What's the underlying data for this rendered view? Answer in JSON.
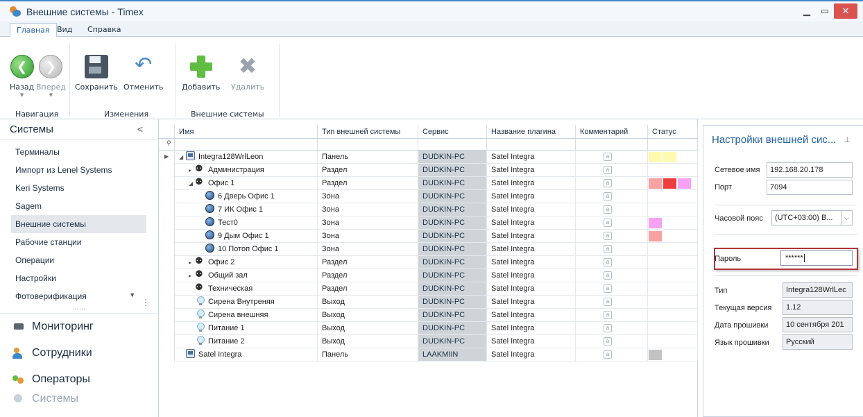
{
  "window": {
    "title": "Внешние системы - Timex"
  },
  "ribbon": {
    "tabs": [
      "Главная",
      "Вид",
      "Справка"
    ],
    "buttons": {
      "back": "Назад",
      "forward": "Вперед",
      "save": "Сохранить",
      "undo": "Отменить",
      "add": "Добавить",
      "delete": "Удалить"
    },
    "groups": {
      "navigation": "Навигация",
      "changes": "Изменения",
      "external_systems": "Внешние системы"
    }
  },
  "left_panel": {
    "header": "Системы",
    "items": [
      "Терминалы",
      "Импорт из Lenel Systems",
      "Keri Systems",
      "Sagem",
      "Внешние системы",
      "Рабочие станции",
      "Операции",
      "Настройки",
      "Фотоверификация"
    ],
    "selected": "Внешние системы",
    "splitter_dots": "......",
    "sections": [
      "Мониторинг",
      "Сотрудники",
      "Операторы",
      "Системы"
    ]
  },
  "grid": {
    "columns": [
      "Имя",
      "Тип внешней системы",
      "Сервис",
      "Название плагина",
      "Комментарий",
      "Статус"
    ],
    "comment_glyph": "a",
    "rows": [
      {
        "name": "Integra128WrlLeon",
        "type": "Панель",
        "service": "DUDKIN-PC",
        "plugin": "Satel Integra",
        "icon": "panel",
        "indent": 1,
        "expander": "◢",
        "status": [
          "#fefbb0",
          "#fefbb0"
        ]
      },
      {
        "name": "Администрация",
        "type": "Раздел",
        "service": "DUDKIN-PC",
        "plugin": "Satel Integra",
        "icon": "section",
        "indent": 2,
        "expander": "▸",
        "status": []
      },
      {
        "name": "Офис 1",
        "type": "Раздел",
        "service": "DUDKIN-PC",
        "plugin": "Satel Integra",
        "icon": "section",
        "indent": 2,
        "expander": "◢",
        "status": [
          "#f7a1a1",
          "#ef3d3d",
          "#f7a1f5"
        ]
      },
      {
        "name": "6 Дверь Офис 1",
        "type": "Зона",
        "service": "DUDKIN-PC",
        "plugin": "Satel Integra",
        "icon": "zone",
        "indent": 3,
        "expander": "",
        "status": []
      },
      {
        "name": "7 ИК Офис 1",
        "type": "Зона",
        "service": "DUDKIN-PC",
        "plugin": "Satel Integra",
        "icon": "zone",
        "indent": 3,
        "expander": "",
        "status": []
      },
      {
        "name": "Тест0",
        "type": "Зона",
        "service": "DUDKIN-PC",
        "plugin": "Satel Integra",
        "icon": "zone",
        "indent": 3,
        "expander": "",
        "status": [
          "#f7a1f5"
        ]
      },
      {
        "name": "9 Дым Офис 1",
        "type": "Зона",
        "service": "DUDKIN-PC",
        "plugin": "Satel Integra",
        "icon": "zone",
        "indent": 3,
        "expander": "",
        "status": [
          "#f7a1a1"
        ]
      },
      {
        "name": "10 Потоп Офис 1",
        "type": "Зона",
        "service": "DUDKIN-PC",
        "plugin": "Satel Integra",
        "icon": "zone",
        "indent": 3,
        "expander": "",
        "status": []
      },
      {
        "name": "Офис 2",
        "type": "Раздел",
        "service": "DUDKIN-PC",
        "plugin": "Satel Integra",
        "icon": "section",
        "indent": 2,
        "expander": "▸",
        "status": []
      },
      {
        "name": "Общий зал",
        "type": "Раздел",
        "service": "DUDKIN-PC",
        "plugin": "Satel Integra",
        "icon": "section",
        "indent": 2,
        "expander": "▸",
        "status": []
      },
      {
        "name": "Техническая",
        "type": "Раздел",
        "service": "DUDKIN-PC",
        "plugin": "Satel Integra",
        "icon": "section",
        "indent": 2,
        "expander": "",
        "status": []
      },
      {
        "name": "Сирена Внутреняя",
        "type": "Выход",
        "service": "DUDKIN-PC",
        "plugin": "Satel Integra",
        "icon": "output",
        "indent": 2,
        "expander": "",
        "status": []
      },
      {
        "name": "Сирена внешняя",
        "type": "Выход",
        "service": "DUDKIN-PC",
        "plugin": "Satel Integra",
        "icon": "output",
        "indent": 2,
        "expander": "",
        "status": []
      },
      {
        "name": "Питание 1",
        "type": "Выход",
        "service": "DUDKIN-PC",
        "plugin": "Satel Integra",
        "icon": "output",
        "indent": 2,
        "expander": "",
        "status": []
      },
      {
        "name": "Питание 2",
        "type": "Выход",
        "service": "DUDKIN-PC",
        "plugin": "Satel Integra",
        "icon": "output",
        "indent": 2,
        "expander": "",
        "status": []
      },
      {
        "name": "Satel Integra",
        "type": "Панель",
        "service": "LAAKMIIN",
        "plugin": "Satel Integra",
        "icon": "panel",
        "indent": 1,
        "expander": "",
        "status": [
          "#c2c2c2"
        ]
      }
    ]
  },
  "properties": {
    "title": "Настройки внешней сис...",
    "network_name_label": "Сетевое имя",
    "network_name": "192.168.20.178",
    "port_label": "Порт",
    "port": "7094",
    "timezone_label": "Часовой пояс",
    "timezone": "(UTC+03:00) В...",
    "password_label": "Пароль",
    "password": "******",
    "type_label": "Тип",
    "type": "Integra128WrlLec",
    "version_label": "Текущая версия",
    "version": "1.12",
    "firmware_date_label": "Дата прошивки",
    "firmware_date": "10 сентября 201",
    "firmware_lang_label": "Язык прошивки",
    "firmware_lang": "Русский"
  }
}
